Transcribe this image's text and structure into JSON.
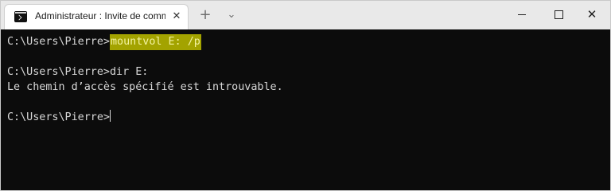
{
  "window": {
    "tab_title": "Administrateur : Invite de comm",
    "tab_icon": "terminal-icon",
    "close_tab_glyph": "✕",
    "new_tab_glyph": "+",
    "dropdown_glyph": "⌄",
    "minimize_icon": "minimize-icon",
    "maximize_icon": "maximize-icon",
    "close_glyph": "✕"
  },
  "console": {
    "lines": [
      {
        "prompt": "C:\\Users\\Pierre>",
        "command": "mountvol E: /p"
      },
      {
        "text": ""
      },
      {
        "prompt": "C:\\Users\\Pierre>",
        "command": "dir E:"
      },
      {
        "text": "Le chemin d’accès spécifié est introuvable."
      },
      {
        "text": ""
      },
      {
        "prompt": "C:\\Users\\Pierre>",
        "command": ""
      }
    ]
  },
  "colors": {
    "console_bg": "#0c0c0c",
    "console_text": "#d8d8d8",
    "highlight_bg": "#a3a300",
    "highlight_text": "#f3f3a0",
    "titlebar_bg": "#e9e9e9"
  }
}
